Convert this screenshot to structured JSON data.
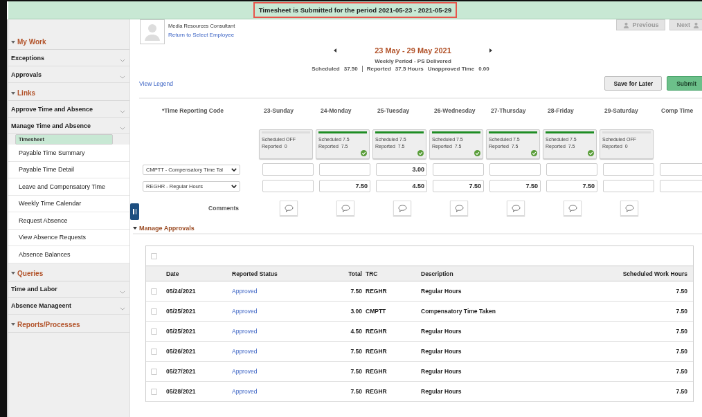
{
  "banner": {
    "message": "Timesheet is Submitted for the period 2021-05-23 - 2021-05-29"
  },
  "sidebar": [
    {
      "title": "My Work",
      "expanded": true,
      "items": [
        {
          "label": "Exceptions",
          "kind": "group"
        },
        {
          "label": "Approvals",
          "kind": "group"
        }
      ]
    },
    {
      "title": "Links",
      "expanded": true,
      "items": [
        {
          "label": "Approve Time and Absence",
          "kind": "group"
        },
        {
          "label": "Manage Time and Absence",
          "kind": "group"
        },
        {
          "label": "Timesheet",
          "kind": "link",
          "selected": true
        },
        {
          "label": "Payable Time Summary",
          "kind": "link",
          "selected": false
        },
        {
          "label": "Payable Time Detail",
          "kind": "link",
          "selected": false
        },
        {
          "label": "Leave and Compensatory Time",
          "kind": "link",
          "selected": false
        },
        {
          "label": "Weekly Time Calendar",
          "kind": "link",
          "selected": false
        },
        {
          "label": "Request Absence",
          "kind": "link",
          "selected": false
        },
        {
          "label": "View Absence Requests",
          "kind": "link",
          "selected": false
        },
        {
          "label": "Absence Balances",
          "kind": "link",
          "selected": false
        }
      ]
    },
    {
      "title": "Queries",
      "expanded": true,
      "items": [
        {
          "label": "Time and Labor",
          "kind": "group"
        },
        {
          "label": "Absence Manageent",
          "kind": "group"
        }
      ]
    },
    {
      "title": "Reports/Processes",
      "expanded": true
    }
  ],
  "employee": {
    "job_title": "Media Resources Consultant",
    "link": "Return to Select Employee"
  },
  "nav_buttons": {
    "previous": "Previous",
    "next": "Next"
  },
  "period": {
    "title": "23 May - 29 May 2021",
    "subtitle": "Weekly Period - PS Delivered",
    "summary": [
      {
        "label": "Scheduled",
        "value": "37.50"
      },
      {
        "label": "Reported",
        "value": "37.5 Hours"
      },
      {
        "label": "Unapproved Time",
        "value": "0.00"
      }
    ]
  },
  "view_legend": "View Legend",
  "actions": {
    "save": "Save for Later",
    "submit": "Submit"
  },
  "grid": {
    "trc_header": "*Time Reporting Code",
    "columns": [
      {
        "label": "23-Sunday",
        "scheduled": "Scheduled OFF",
        "reported": "Reported  0",
        "complete": false
      },
      {
        "label": "24-Monday",
        "scheduled": "Scheduled 7.5",
        "reported": "Reported  7.5",
        "complete": true
      },
      {
        "label": "25-Tuesday",
        "scheduled": "Scheduled 7.5",
        "reported": "Reported  7.5",
        "complete": true
      },
      {
        "label": "26-Wednesday",
        "scheduled": "Scheduled 7.5",
        "reported": "Reported  7.5",
        "complete": true
      },
      {
        "label": "27-Thursday",
        "scheduled": "Scheduled 7.5",
        "reported": "Reported  7.5",
        "complete": true
      },
      {
        "label": "28-Friday",
        "scheduled": "Scheduled 7.5",
        "reported": "Reported  7.5",
        "complete": true
      },
      {
        "label": "29-Saturday",
        "scheduled": "Scheduled OFF",
        "reported": "Reported  0",
        "complete": false
      },
      {
        "label": "Comp Time"
      }
    ],
    "rows": [
      {
        "code": "CMPTT - Compensatory Time Tal",
        "cells": [
          {
            "kind": "empty"
          },
          {
            "kind": "empty"
          },
          {
            "kind": "filled",
            "hours": "3.00"
          },
          {
            "kind": "empty"
          },
          {
            "kind": "empty"
          },
          {
            "kind": "empty"
          },
          {
            "kind": "empty"
          },
          {
            "kind": "empty"
          }
        ]
      },
      {
        "code": "REGHR - Regular Hours",
        "cells": [
          {
            "kind": "empty"
          },
          {
            "kind": "filled",
            "hours": "7.50"
          },
          {
            "kind": "filled",
            "hours": "4.50"
          },
          {
            "kind": "filled",
            "hours": "7.50"
          },
          {
            "kind": "filled",
            "hours": "7.50"
          },
          {
            "kind": "filled",
            "hours": "7.50"
          },
          {
            "kind": "empty"
          },
          {
            "kind": "empty"
          }
        ]
      }
    ],
    "comments_label": "Comments"
  },
  "approvals": {
    "title": "Manage Approvals",
    "expanded": true,
    "select_all": false,
    "columns": [
      "Date",
      "Reported Status",
      "Total",
      "TRC",
      "Description",
      "Scheduled Work Hours"
    ],
    "rows": [
      {
        "checked": false,
        "date": "05/24/2021",
        "status": "Approved",
        "total": "7.50",
        "trc": "REGHR",
        "description": "Regular Hours",
        "scheduled": "7.50"
      },
      {
        "checked": false,
        "date": "05/25/2021",
        "status": "Approved",
        "total": "3.00",
        "trc": "CMPTT",
        "description": "Compensatory Time Taken",
        "scheduled": "7.50"
      },
      {
        "checked": false,
        "date": "05/25/2021",
        "status": "Approved",
        "total": "4.50",
        "trc": "REGHR",
        "description": "Regular Hours",
        "scheduled": "7.50"
      },
      {
        "checked": false,
        "date": "05/26/2021",
        "status": "Approved",
        "total": "7.50",
        "trc": "REGHR",
        "description": "Regular Hours",
        "scheduled": "7.50"
      },
      {
        "checked": false,
        "date": "05/27/2021",
        "status": "Approved",
        "total": "7.50",
        "trc": "REGHR",
        "description": "Regular Hours",
        "scheduled": "7.50"
      },
      {
        "checked": false,
        "date": "05/28/2021",
        "status": "Approved",
        "total": "7.50",
        "trc": "REGHR",
        "description": "Regular Hours",
        "scheduled": "7.50"
      }
    ]
  }
}
